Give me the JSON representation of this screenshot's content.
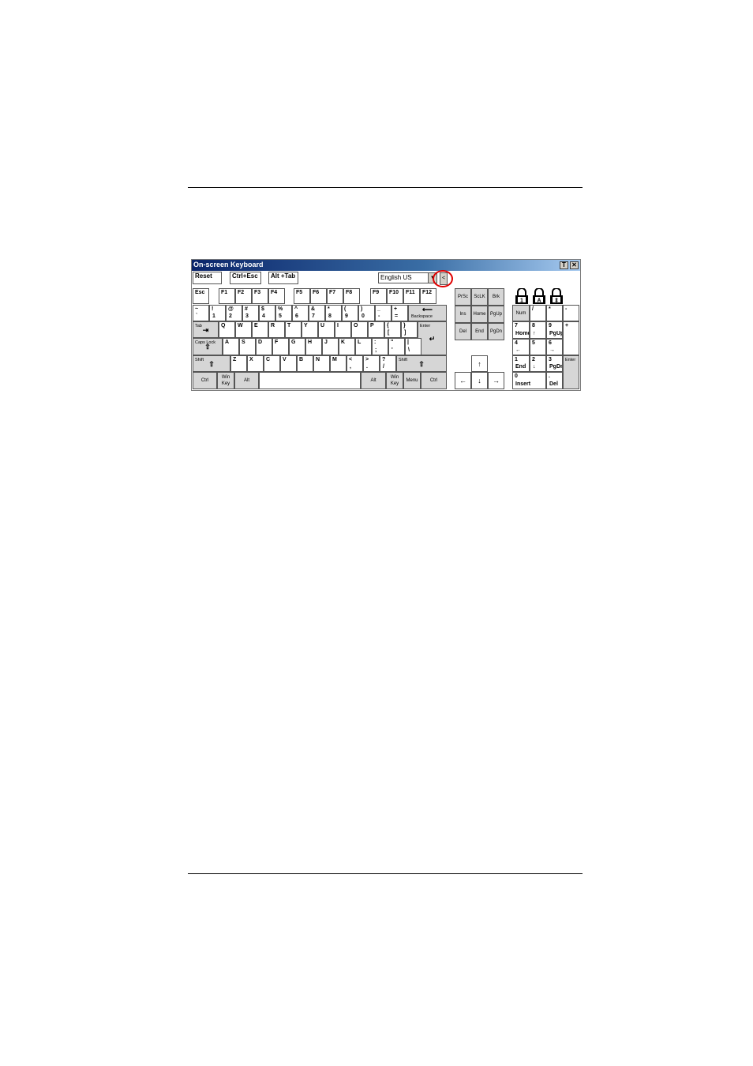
{
  "window": {
    "title": "On-screen Keyboard",
    "title_btn_t": "T",
    "title_btn_x": "✕"
  },
  "toolbar": {
    "reset": "Reset",
    "ctrl_esc": "Ctrl+Esc",
    "alt_tab": "Alt +Tab",
    "language": "English US",
    "collapse": "<"
  },
  "fn_row": [
    "Esc",
    "F1",
    "F2",
    "F3",
    "F4",
    "F5",
    "F6",
    "F7",
    "F8",
    "F9",
    "F10",
    "F11",
    "F12"
  ],
  "num_row": [
    [
      "~",
      "`"
    ],
    [
      "!",
      "1"
    ],
    [
      "@",
      "2"
    ],
    [
      "#",
      "3"
    ],
    [
      "$",
      "4"
    ],
    [
      "%",
      "5"
    ],
    [
      "^",
      "6"
    ],
    [
      "&",
      "7"
    ],
    [
      "*",
      "8"
    ],
    [
      "(",
      "9"
    ],
    [
      ")",
      "0"
    ],
    [
      "_",
      "-"
    ],
    [
      "+",
      "="
    ]
  ],
  "backspace": "Backspace",
  "tab": "Tab",
  "q_row": [
    "Q",
    "W",
    "E",
    "R",
    "T",
    "Y",
    "U",
    "I",
    "O",
    "P"
  ],
  "q_row_extra": [
    [
      "{",
      "["
    ],
    [
      "}",
      "]"
    ]
  ],
  "enter": "Enter",
  "caps": "Caps Lock",
  "a_row": [
    "A",
    "S",
    "D",
    "F",
    "G",
    "H",
    "J",
    "K",
    "L"
  ],
  "a_row_extra": [
    [
      ":",
      ";"
    ],
    [
      "\"",
      "'"
    ],
    [
      "|",
      "\\"
    ]
  ],
  "shift": "Shift",
  "z_row": [
    "Z",
    "X",
    "C",
    "V",
    "B",
    "N",
    "M"
  ],
  "z_row_extra": [
    [
      "<",
      ","
    ],
    [
      ">",
      "."
    ],
    [
      "?",
      "/"
    ]
  ],
  "bottom": {
    "ctrl": "Ctrl",
    "win": "Win Key",
    "alt": "Alt",
    "menu": "Menu"
  },
  "nav": [
    "PrSc",
    "ScLK",
    "Brk",
    "Ins",
    "Home",
    "PgUp",
    "Del",
    "End",
    "PgDn"
  ],
  "numpad": {
    "num": "Num",
    "div": "/",
    "mul": "*",
    "sub": "-",
    "add": "+",
    "enter": "Enter",
    "k7": [
      "7",
      "Home"
    ],
    "k8": [
      "8",
      "↑"
    ],
    "k9": [
      "9",
      "PgUp"
    ],
    "k4": [
      "4",
      "←"
    ],
    "k5": [
      "5",
      ""
    ],
    "k6": [
      "6",
      "→"
    ],
    "k1": [
      "1",
      "End"
    ],
    "k2": [
      "2",
      "↓"
    ],
    "k3": [
      "3",
      "PgDn"
    ],
    "k0": [
      "0",
      "Insert"
    ],
    "kdot": [
      ".",
      "Del"
    ]
  },
  "locks": {
    "num": "1",
    "caps": "A",
    "scroll": "⇕"
  }
}
